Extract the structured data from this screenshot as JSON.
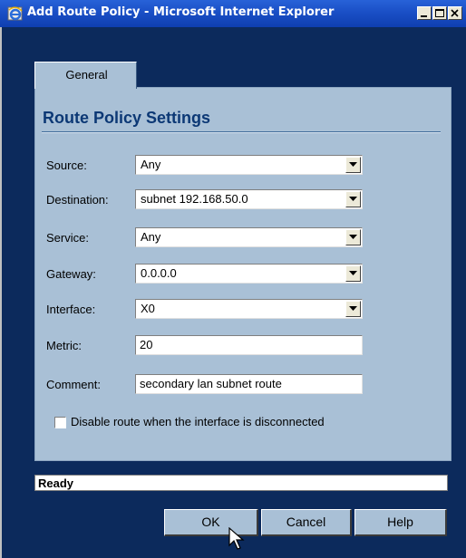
{
  "window": {
    "title": "Add Route Policy - Microsoft Internet Explorer",
    "icon": "ie-icon",
    "controls": [
      "minimize-icon",
      "maximize-icon",
      "close-icon"
    ]
  },
  "tabs": [
    {
      "label": "General",
      "active": true
    }
  ],
  "section": {
    "title": "Route Policy Settings"
  },
  "form": {
    "source": {
      "label": "Source:",
      "value": "Any"
    },
    "destination": {
      "label": "Destination:",
      "value": "subnet 192.168.50.0"
    },
    "service": {
      "label": "Service:",
      "value": "Any"
    },
    "gateway": {
      "label": "Gateway:",
      "value": "0.0.0.0"
    },
    "interface": {
      "label": "Interface:",
      "value": "X0"
    },
    "metric": {
      "label": "Metric:",
      "value": "20"
    },
    "comment": {
      "label": "Comment:",
      "value": "secondary lan subnet route"
    },
    "disable_route": {
      "label": "Disable route when the interface is disconnected",
      "checked": false
    }
  },
  "status_bar": {
    "text": "Ready"
  },
  "buttons": {
    "ok": "OK",
    "cancel": "Cancel",
    "help": "Help"
  },
  "colors": {
    "window_bg": "#0c2a5c",
    "panel_bg": "#a9c0d6",
    "title_bar": "#1a4fc6",
    "section_title": "#0c3875"
  }
}
